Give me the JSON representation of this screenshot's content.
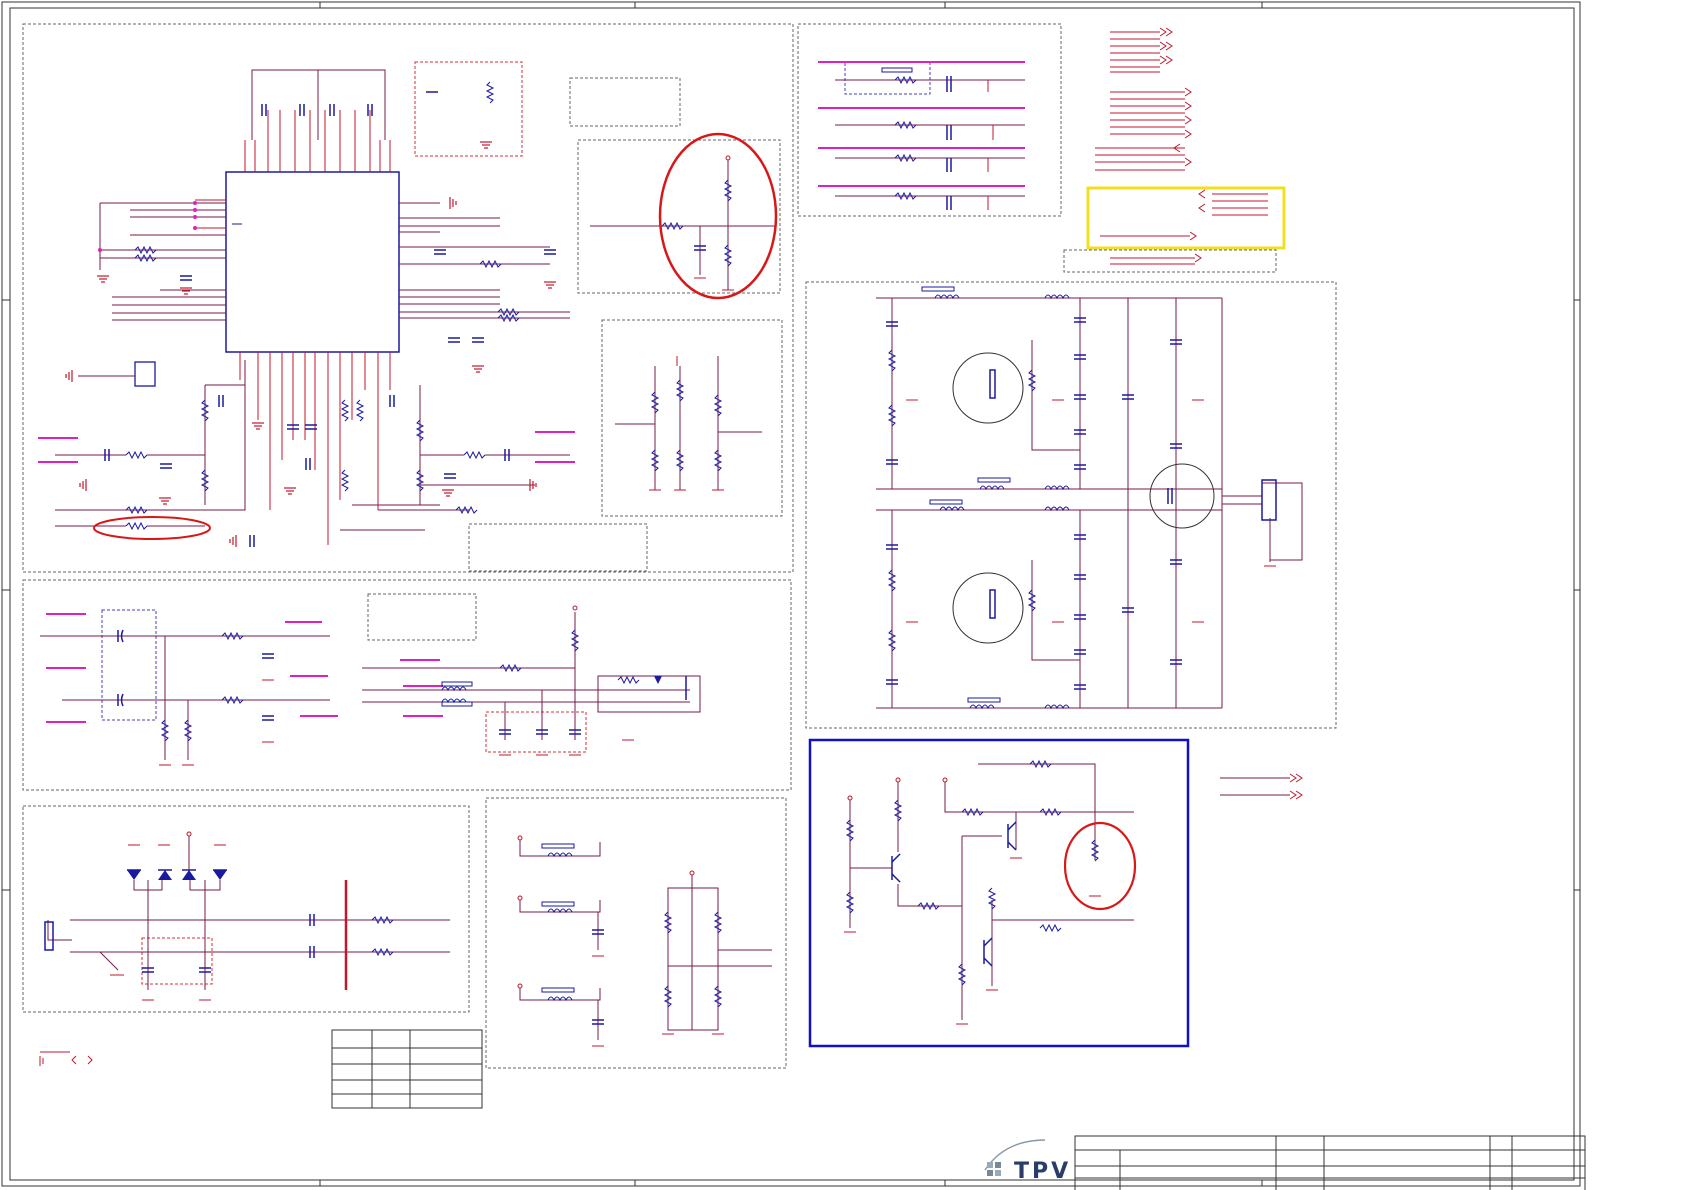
{
  "logo": {
    "text": "TPV",
    "icon": "tpv-logo-icon"
  },
  "colors": {
    "wire": "#7a1a4a",
    "component": "#c0172b",
    "chip": "#1a1aa0",
    "net_label": "#e020c0",
    "highlight_red": "#d81818",
    "highlight_yellow": "#f0e020",
    "highlight_blue": "#1010c8",
    "frame": "#333333",
    "dashed_box": "#666666"
  }
}
